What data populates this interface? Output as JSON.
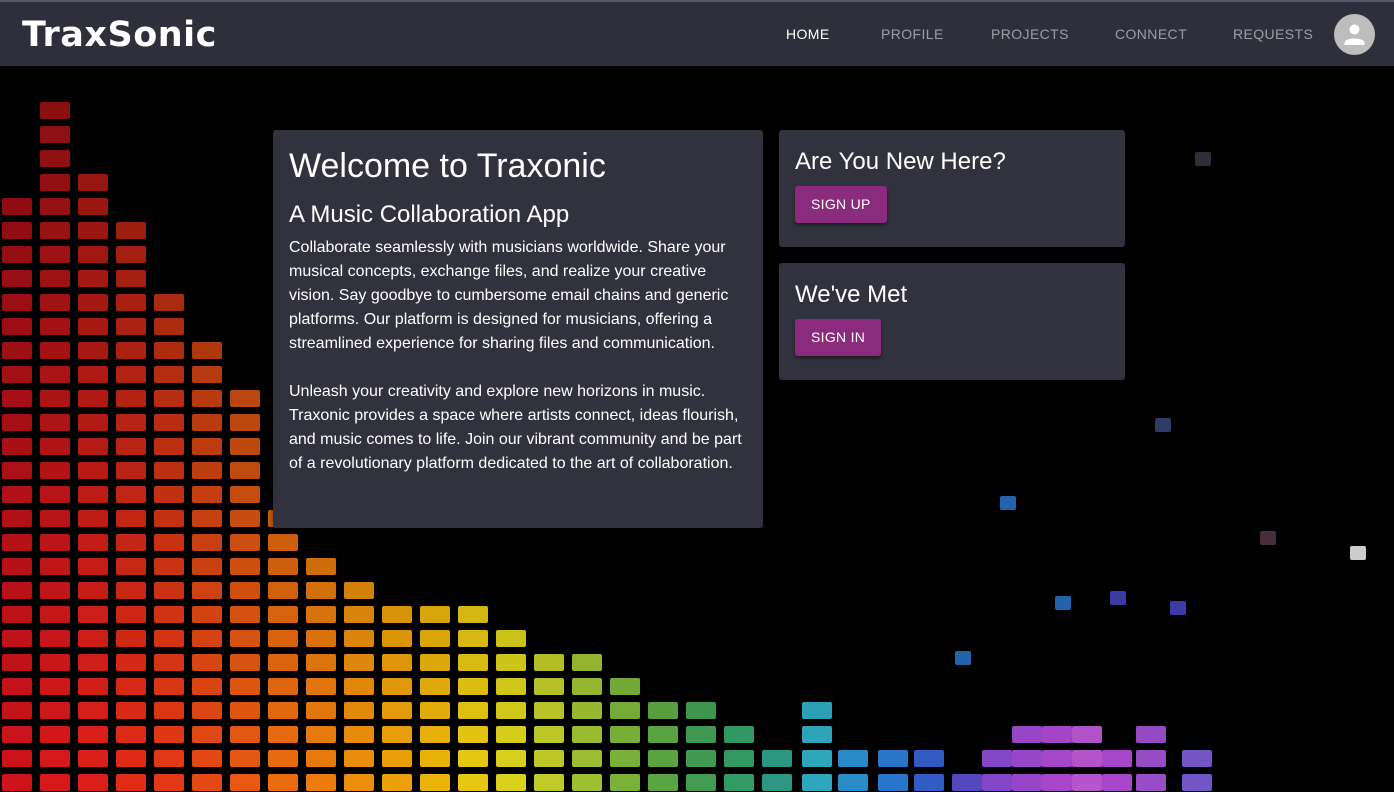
{
  "header": {
    "logo": "TraxSonic",
    "nav": [
      {
        "label": "HOME",
        "active": true
      },
      {
        "label": "PROFILE",
        "active": false
      },
      {
        "label": "PROJECTS",
        "active": false
      },
      {
        "label": "CONNECT",
        "active": false
      },
      {
        "label": "REQUESTS",
        "active": false
      }
    ],
    "avatar_icon": "person-icon"
  },
  "welcome": {
    "title": "Welcome to Traxonic",
    "subtitle": "A Music Collaboration App",
    "paragraphs": [
      "Collaborate seamlessly with musicians worldwide. Share your musical concepts, exchange files, and realize your creative vision. Say goodbye to cumbersome email chains and generic platforms. Our platform is designed for musicians, offering a streamlined experience for sharing files and communication.",
      "Unleash your creativity and explore new horizons in music. Traxonic provides a space where artists connect, ideas flourish, and music comes to life. Join our vibrant community and be part of a revolutionary platform dedicated to the art of collaboration."
    ]
  },
  "signup": {
    "heading": "Are You New Here?",
    "button": "SIGN UP"
  },
  "signin": {
    "heading": "We've Met",
    "button": "SIGN IN"
  },
  "colors": {
    "navbar": "#2f2f3c",
    "card": "#32323f",
    "button": "#8b2b7d",
    "background": "#000000"
  }
}
